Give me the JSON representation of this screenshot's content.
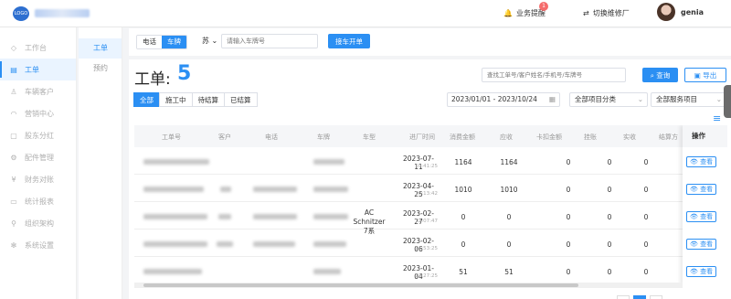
{
  "header": {
    "logo_text": "LOGO",
    "reminder_label": "业务提醒",
    "reminder_count": "1",
    "switch_label": "切换维修厂",
    "username": "genia"
  },
  "sidebar": {
    "items": [
      {
        "label": "工作台",
        "icon": "dashboard-icon"
      },
      {
        "label": "工单",
        "icon": "document-icon"
      },
      {
        "label": "车辆客户",
        "icon": "user-icon"
      },
      {
        "label": "营销中心",
        "icon": "headset-icon"
      },
      {
        "label": "股东分红",
        "icon": "share-icon"
      },
      {
        "label": "配件管理",
        "icon": "gear-icon"
      },
      {
        "label": "财务对账",
        "icon": "yen-icon"
      },
      {
        "label": "统计报表",
        "icon": "monitor-icon"
      },
      {
        "label": "组织架构",
        "icon": "org-icon"
      },
      {
        "label": "系统设置",
        "icon": "settings-icon"
      }
    ]
  },
  "subnav": {
    "items": [
      "工单",
      "预约"
    ]
  },
  "quickbar": {
    "seg_phone": "电话",
    "seg_plate": "车牌",
    "province": "苏",
    "plate_placeholder": "请输入车牌号",
    "open_button": "接车开单"
  },
  "main": {
    "title": "工单:",
    "count": "5",
    "search_placeholder": "查找工单号/客户姓名/手机号/车牌号",
    "query_button": "查询",
    "export_button": "导出",
    "tabs": [
      "全部",
      "施工中",
      "待结算",
      "已结算"
    ],
    "date_range": "2023/01/01 - 2023/10/24",
    "project_category": "全部项目分类",
    "service_project": "全部服务项目"
  },
  "table": {
    "headers": [
      "工单号",
      "客户",
      "电话",
      "车牌",
      "车型",
      "进厂时间",
      "消费金额",
      "应收",
      "卡扣金额",
      "挂账",
      "实收",
      "结算方"
    ],
    "op_header": "操作",
    "view_label": "查看",
    "rows": [
      {
        "car_model": "",
        "date": "2023-07-11",
        "time": "10:41:25",
        "amount": "1164",
        "receivable": "1164",
        "card": "0",
        "credit": "0",
        "received": "0"
      },
      {
        "car_model": "",
        "date": "2023-04-25",
        "time": "10:13:42",
        "amount": "1010",
        "receivable": "1010",
        "card": "0",
        "credit": "0",
        "received": "0"
      },
      {
        "car_model": "AC Schnitzer 7系",
        "date": "2023-02-27",
        "time": "12:07:47",
        "amount": "0",
        "receivable": "0",
        "card": "0",
        "credit": "0",
        "received": "0"
      },
      {
        "car_model": "",
        "date": "2023-02-06",
        "time": "11:53:25",
        "amount": "0",
        "receivable": "0",
        "card": "0",
        "credit": "0",
        "received": "0"
      },
      {
        "car_model": "",
        "date": "2023-01-04",
        "time": "17:27:25",
        "amount": "51",
        "receivable": "51",
        "card": "0",
        "credit": "0",
        "received": "0"
      }
    ]
  }
}
